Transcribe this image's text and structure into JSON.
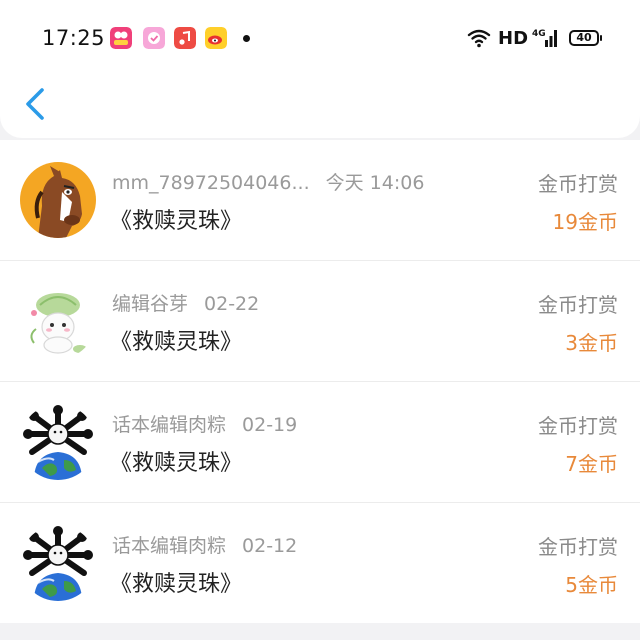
{
  "status_bar": {
    "time": "17:25",
    "network_label": "HD",
    "signal_label": "4G",
    "battery_level": "40",
    "icons": [
      "app-icon-red",
      "app-icon-pink",
      "music-app-icon",
      "weibo-icon",
      "wifi-icon",
      "signal-icon",
      "battery-icon"
    ]
  },
  "header": {
    "back_icon": "chevron-left-icon",
    "accent_color": "#2b9be8"
  },
  "records": [
    {
      "user": "mm_78972504046...",
      "date": "今天 14:06",
      "book": "《救赎灵珠》",
      "kind": "金币打赏",
      "amount": "19金币",
      "avatar": "horse-avatar"
    },
    {
      "user": "编辑谷芽",
      "date": "02-22",
      "book": "《救赎灵珠》",
      "kind": "金币打赏",
      "amount": "3金币",
      "avatar": "bunny-avatar"
    },
    {
      "user": "话本编辑肉粽",
      "date": "02-19",
      "book": "《救赎灵珠》",
      "kind": "金币打赏",
      "amount": "7金币",
      "avatar": "globe-avatar"
    },
    {
      "user": "话本编辑肉粽",
      "date": "02-12",
      "book": "《救赎灵珠》",
      "kind": "金币打赏",
      "amount": "5金币",
      "avatar": "globe-avatar"
    }
  ],
  "colors": {
    "amount": "#e8893a",
    "meta": "#9a9a9a",
    "background": "#f2f2f4"
  }
}
